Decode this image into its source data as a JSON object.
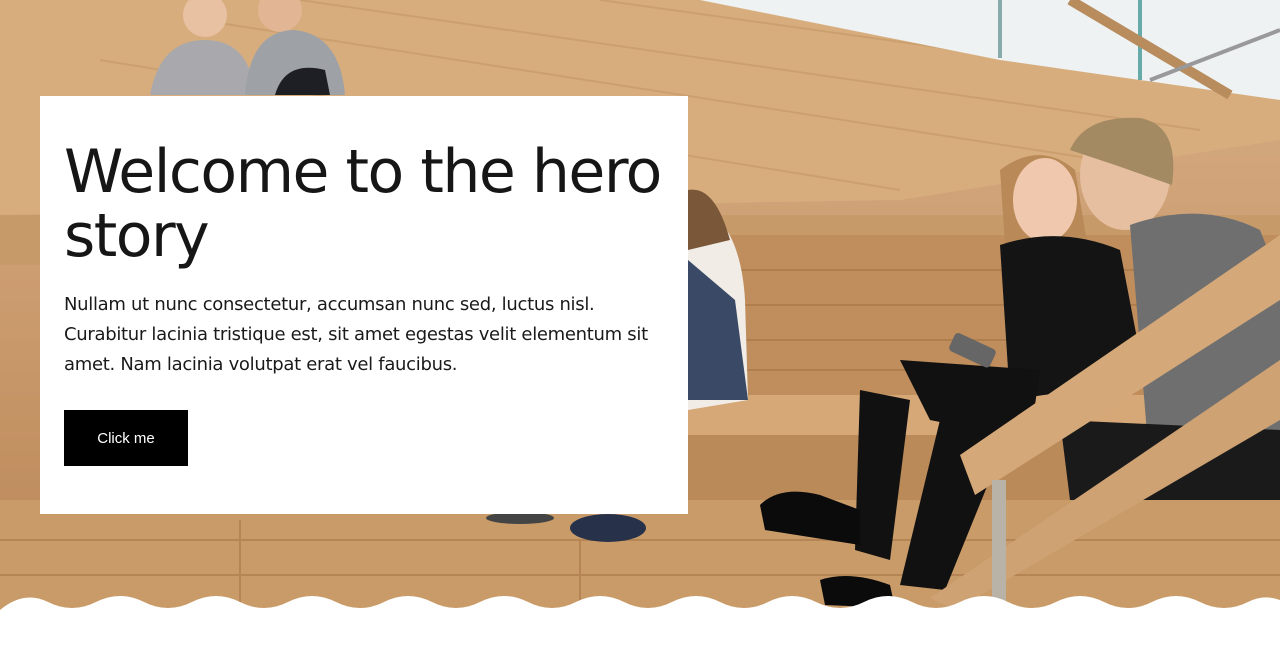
{
  "hero": {
    "title": "Welcome to the hero story",
    "body": "Nullam ut nunc consectetur, accumsan nunc sed, luctus nisl. Curabitur lacinia tristique est, sit amet egestas velit elementum sit amet. Nam lacinia volutpat erat vel faucibus.",
    "cta_label": "Click me"
  },
  "colors": {
    "card_bg": "#ffffff",
    "button_bg": "#000000",
    "button_text": "#ffffff",
    "wood": "#cfa176"
  }
}
